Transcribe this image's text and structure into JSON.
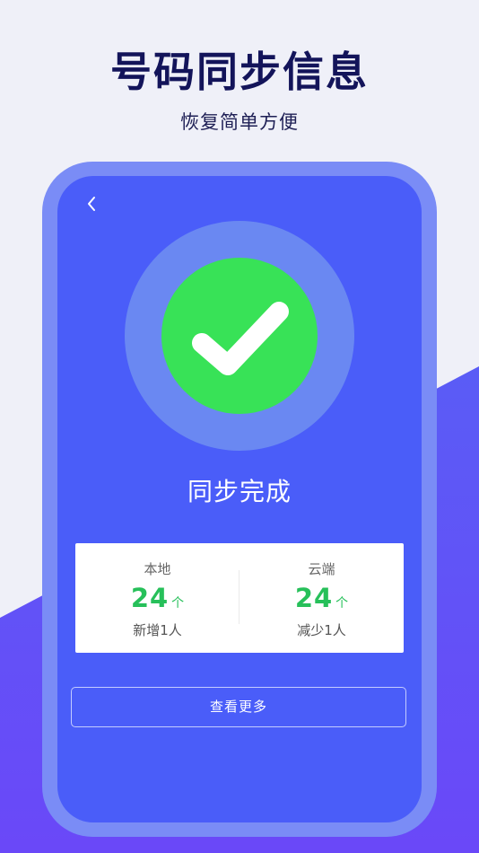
{
  "hero": {
    "title": "号码同步信息",
    "subtitle": "恢复简单方便"
  },
  "phone": {
    "back_icon": "chevron-left-icon",
    "status_icon": "check-icon",
    "status_title": "同步完成",
    "stats": {
      "local": {
        "label": "本地",
        "value": "24",
        "unit": "个",
        "change": "新增1人"
      },
      "cloud": {
        "label": "云端",
        "value": "24",
        "unit": "个",
        "change": "减少1人"
      }
    },
    "more_button_label": "查看更多"
  },
  "colors": {
    "background": "#eff0f8",
    "wave_top": "#5a5cf6",
    "wave_bottom": "#6a48f8",
    "phone_frame": "#7a8cf6",
    "phone_screen": "#4a5df9",
    "success_ring": "#6a88f2",
    "success_green": "#38e257",
    "stat_green": "#27c05a",
    "title_navy": "#13145a"
  }
}
